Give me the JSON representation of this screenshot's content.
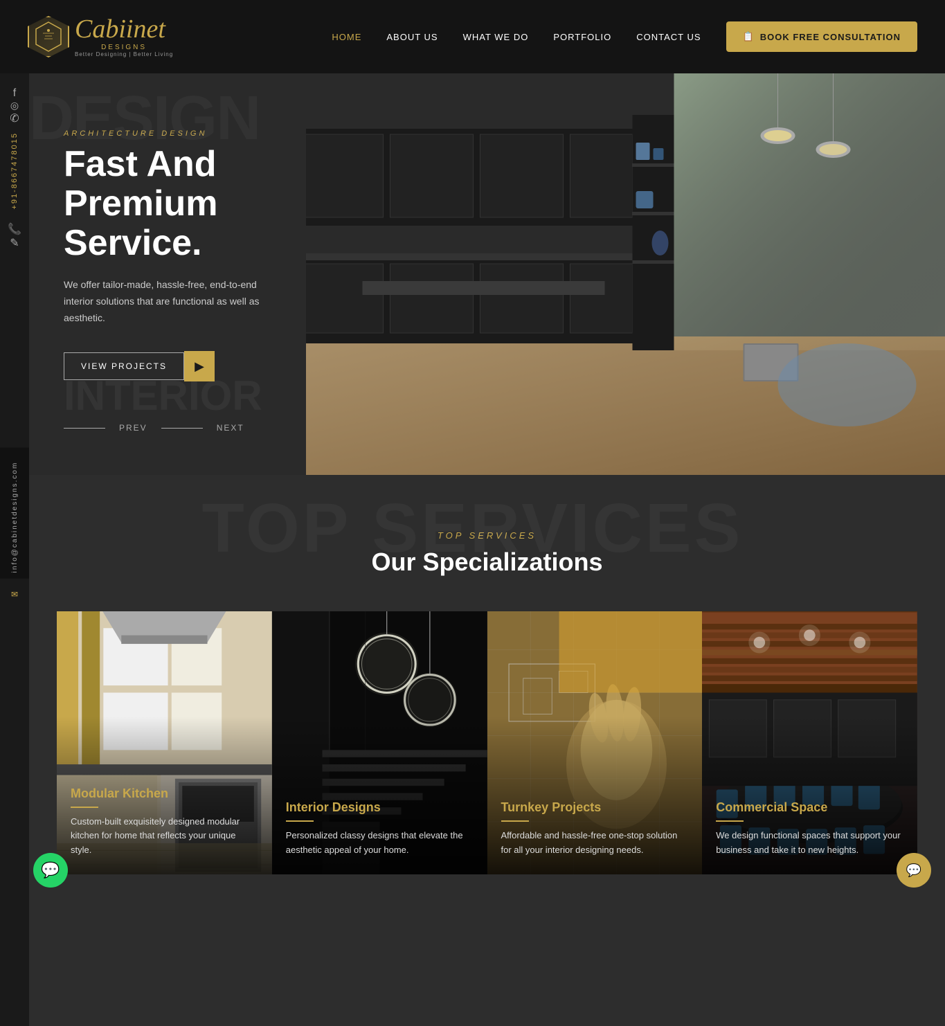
{
  "nav": {
    "logo": {
      "icon_symbol": "⬡",
      "brand_name": "Cabiinet",
      "brand_suffix": "DESIGNS",
      "tagline": "Better Designing | Better Living"
    },
    "links": [
      {
        "label": "HOME",
        "active": true
      },
      {
        "label": "ABOUT US",
        "active": false
      },
      {
        "label": "WHAT WE DO",
        "active": false
      },
      {
        "label": "PORTFOLIO",
        "active": false
      },
      {
        "label": "CONTACT US",
        "active": false
      }
    ],
    "cta_icon": "📋",
    "cta_label": "BOOK FREE CONSULTATION"
  },
  "sidebar": {
    "phone": "+91-8667478015",
    "email": "info@cabinetdesigns.com",
    "social": {
      "facebook": "f",
      "instagram": "◎",
      "whatsapp": "✆"
    }
  },
  "hero": {
    "bg_text": "DESIGN",
    "arch_label": "ARCHITECTURE DESIGN",
    "title": "Fast And Premium Service.",
    "description": "We offer tailor-made, hassle-free, end-to-end interior solutions that are functional as well as aesthetic.",
    "cta_label": "VIEW PROJECTS",
    "cta_arrow": "▶",
    "prev_label": "PREV",
    "next_label": "NEXT",
    "interior_bg": "INTERIOR"
  },
  "specializations": {
    "bg_text": "TOP SERVICES",
    "section_label": "TOP SERVICES",
    "section_title": "Our Specializations",
    "cards": [
      {
        "id": "modular-kitchen",
        "title": "Modular Kitchen",
        "description": "Custom-built exquisitely designed modular kitchen for home that reflects your unique style."
      },
      {
        "id": "interior-designs",
        "title": "Interior Designs",
        "description": "Personalized classy designs that elevate the aesthetic appeal of your home."
      },
      {
        "id": "turnkey-projects",
        "title": "Turnkey Projects",
        "description": "Affordable and hassle-free one-stop solution for all your interior designing needs."
      },
      {
        "id": "commercial-space",
        "title": "Commercial Space",
        "description": "We design functional spaces that support your business and take it to new heights."
      }
    ]
  },
  "floating": {
    "whatsapp_icon": "💬",
    "chat_icon": "💬",
    "phone_icon": "✎"
  }
}
